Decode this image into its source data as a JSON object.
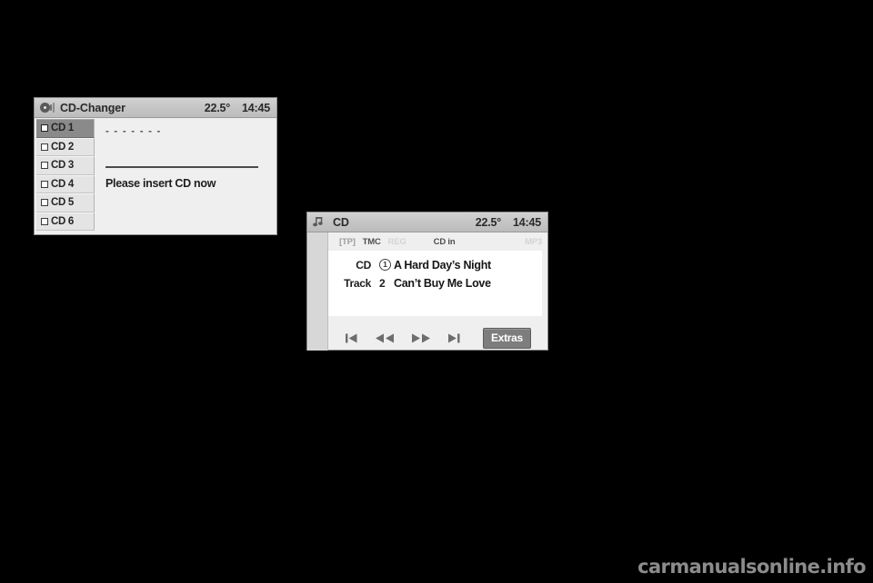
{
  "page": {
    "background_color": "#000000",
    "watermark": "carmanualsonline.info"
  },
  "cd_changer": {
    "header": {
      "icon": "cd-disc-icon",
      "title": "CD-Changer",
      "temperature": "22.5°",
      "clock": "14:45"
    },
    "discs": [
      {
        "label": "CD 1",
        "selected": true
      },
      {
        "label": "CD 2",
        "selected": false
      },
      {
        "label": "CD 3",
        "selected": false
      },
      {
        "label": "CD 4",
        "selected": false
      },
      {
        "label": "CD 5",
        "selected": false
      },
      {
        "label": "CD 6",
        "selected": false
      }
    ],
    "content": {
      "placeholder_dashes": "- - - - - - -",
      "message": "Please insert CD now"
    }
  },
  "cd_player": {
    "header": {
      "icon": "music-note-icon",
      "title": "CD",
      "temperature": "22.5°",
      "clock": "14:45"
    },
    "status_flags": [
      {
        "label": "[TP]",
        "state": "dim"
      },
      {
        "label": "TMC",
        "state": "on"
      },
      {
        "label": "REG",
        "state": "off"
      },
      {
        "label": "CD in",
        "state": "on"
      },
      {
        "label": "MP3",
        "state": "off"
      }
    ],
    "tracks": [
      {
        "tag": "CD",
        "number": "1",
        "number_circled": true,
        "title": "A Hard Day’s Night"
      },
      {
        "tag": "Track",
        "number": "2",
        "number_circled": false,
        "title": "Can’t Buy Me Love"
      }
    ],
    "transport": [
      {
        "name": "skip-previous",
        "icon": "skip-back-icon"
      },
      {
        "name": "rewind",
        "icon": "rewind-icon"
      },
      {
        "name": "fast-forward",
        "icon": "fast-forward-icon"
      },
      {
        "name": "skip-next",
        "icon": "skip-forward-icon"
      }
    ],
    "extras_label": "Extras"
  }
}
